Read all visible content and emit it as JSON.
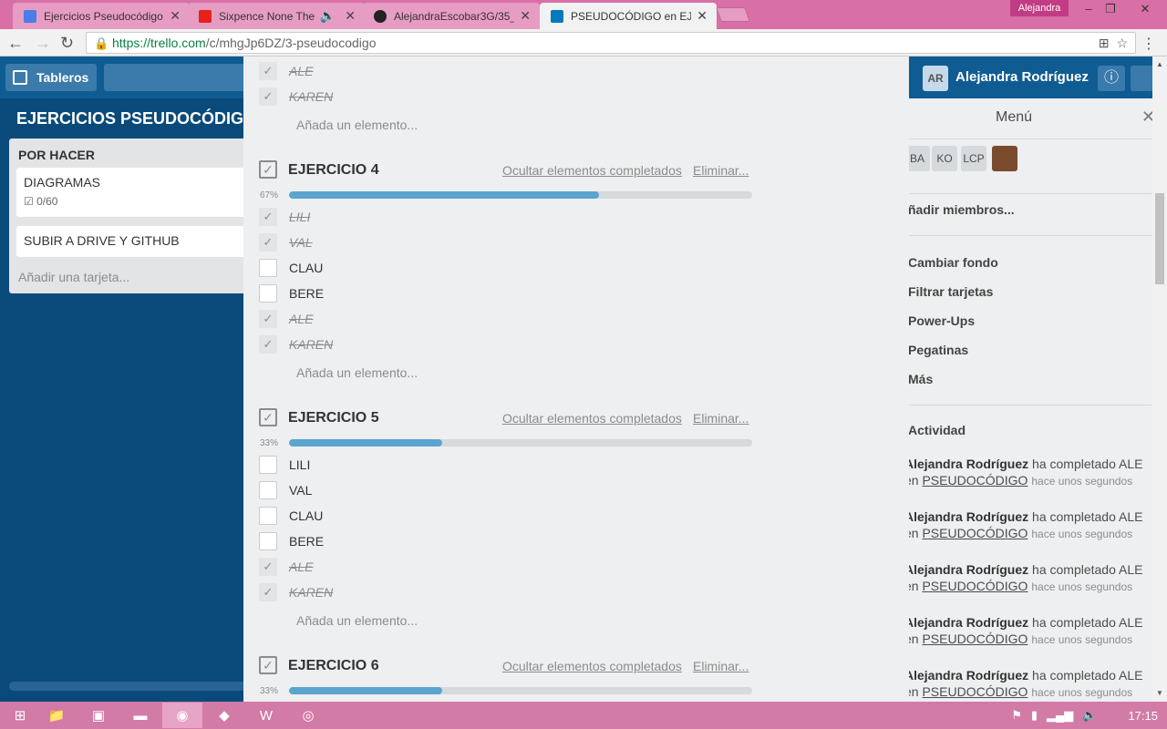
{
  "browser": {
    "tabs": [
      {
        "title": "Ejercicios Pseudocódigo",
        "icon": "docs-icon",
        "color": "#4a7de8",
        "active": false
      },
      {
        "title": "Sixpence None The R",
        "icon": "youtube-icon",
        "color": "#e62117",
        "active": false
      },
      {
        "title": "AlejandraEscobar3G/35_",
        "icon": "github-icon",
        "color": "#222222",
        "active": false
      },
      {
        "title": "PSEUDOCÓDIGO en EJE",
        "icon": "trello-icon",
        "color": "#0079bf",
        "active": true
      }
    ],
    "profile_name": "Alejandra",
    "url_host": "https://trello.com",
    "url_path": "/c/mhgJp6DZ/3-pseudocodigo"
  },
  "trello": {
    "boards_label": "Tableros",
    "board_title": "EJERCICIOS PSEUDOCÓDIGO",
    "user_initials": "AR",
    "user_name": "Alejandra Rodríguez",
    "list": {
      "title": "POR HACER",
      "cards": [
        {
          "title": "DIAGRAMAS",
          "badge": "0/60"
        },
        {
          "title": "SUBIR A DRIVE Y GITHUB"
        }
      ],
      "add_card": "Añadir una tarjeta..."
    },
    "menu": {
      "title": "Menú",
      "members": [
        "BA",
        "KO",
        "LCP"
      ],
      "add_members": "ñadir miembros...",
      "items": [
        "Cambiar fondo",
        "Filtrar tarjetas",
        "Power-Ups",
        "Pegatinas",
        "Más"
      ],
      "activity_title": "Actividad",
      "activity": [
        {
          "user": "Alejandra Rodríguez",
          "action": "ha completado ALE",
          "prefix": "en",
          "card": "PSEUDOCÓDIGO",
          "time": "hace unos segundos"
        },
        {
          "user": "Alejandra Rodríguez",
          "action": "ha completado ALE",
          "prefix": "en",
          "card": "PSEUDOCÓDIGO",
          "time": "hace unos segundos"
        },
        {
          "user": "Alejandra Rodríguez",
          "action": "ha completado ALE",
          "prefix": "en",
          "card": "PSEUDOCÓDIGO",
          "time": "hace unos segundos"
        },
        {
          "user": "Alejandra Rodríguez",
          "action": "ha completado ALE",
          "prefix": "en",
          "card": "PSEUDOCÓDIGO",
          "time": "hace unos segundos"
        },
        {
          "user": "Alejandra Rodríguez",
          "action": "ha completado ALE",
          "prefix": "en",
          "card": "PSEUDOCÓDIGO",
          "time": "hace unos segundos"
        }
      ]
    }
  },
  "card_detail": {
    "top_items": [
      {
        "label": "ALE",
        "done": true
      },
      {
        "label": "KAREN",
        "done": true
      }
    ],
    "add_item": "Añada un elemento...",
    "hide_completed": "Ocultar elementos completados",
    "delete": "Eliminar...",
    "checklists": [
      {
        "title": "EJERCICIO 4",
        "progress_label": "67%",
        "progress": 0.67,
        "items": [
          {
            "label": "LILI",
            "done": true
          },
          {
            "label": "VAL",
            "done": true
          },
          {
            "label": "CLAU",
            "done": false
          },
          {
            "label": "BERE",
            "done": false
          },
          {
            "label": "ALE",
            "done": true
          },
          {
            "label": "KAREN",
            "done": true
          }
        ]
      },
      {
        "title": "EJERCICIO 5",
        "progress_label": "33%",
        "progress": 0.33,
        "items": [
          {
            "label": "LILI",
            "done": false
          },
          {
            "label": "VAL",
            "done": false
          },
          {
            "label": "CLAU",
            "done": false
          },
          {
            "label": "BERE",
            "done": false
          },
          {
            "label": "ALE",
            "done": true
          },
          {
            "label": "KAREN",
            "done": true
          }
        ]
      },
      {
        "title": "EJERCICIO 6",
        "progress_label": "33%",
        "progress": 0.33,
        "items": []
      }
    ]
  },
  "taskbar": {
    "clock": "17:15"
  }
}
